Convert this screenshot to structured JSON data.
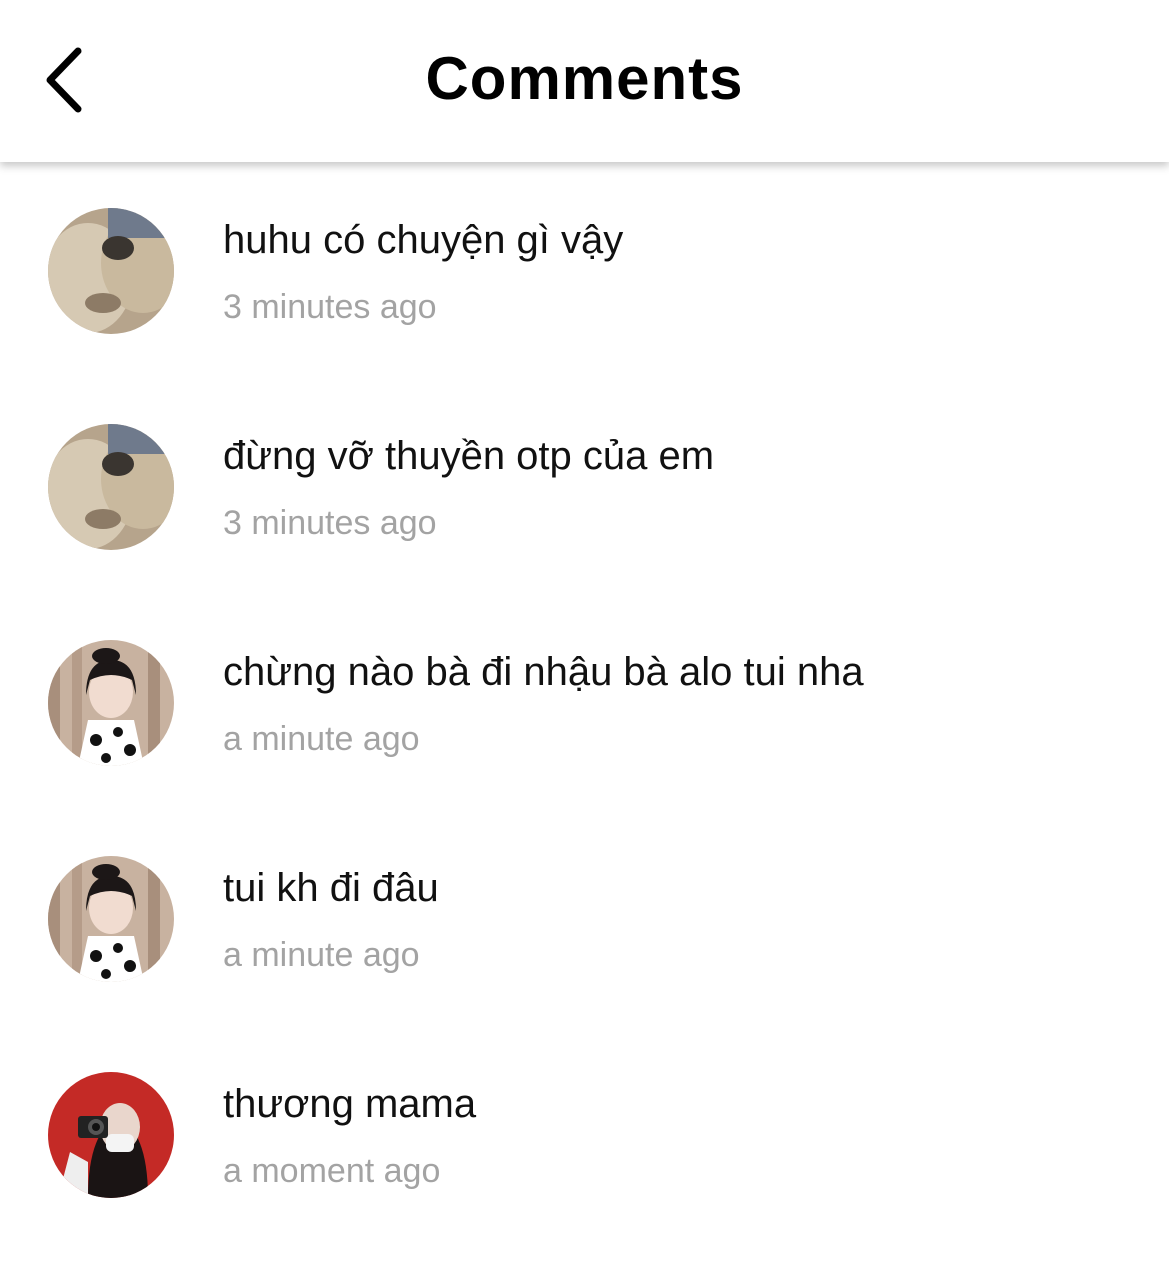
{
  "header": {
    "title": "Comments",
    "back_icon": "chevron-left-icon"
  },
  "comments": [
    {
      "text": "huhu có chuyện gì vậy",
      "time": "3 minutes ago",
      "avatar": "cats-avatar"
    },
    {
      "text": "đừng vỡ thuyền otp của em",
      "time": "3 minutes ago",
      "avatar": "cats-avatar"
    },
    {
      "text": "chừng nào bà đi nhậu bà alo tui nha",
      "time": "a minute ago",
      "avatar": "girl-bow-avatar"
    },
    {
      "text": "tui kh đi đâu",
      "time": "a minute ago",
      "avatar": "girl-bow-avatar"
    },
    {
      "text": "thương mama",
      "time": "a moment ago",
      "avatar": "camera-girl-avatar"
    }
  ],
  "colors": {
    "text": "#111111",
    "timestamp": "#a3a3a3",
    "background": "#ffffff"
  }
}
